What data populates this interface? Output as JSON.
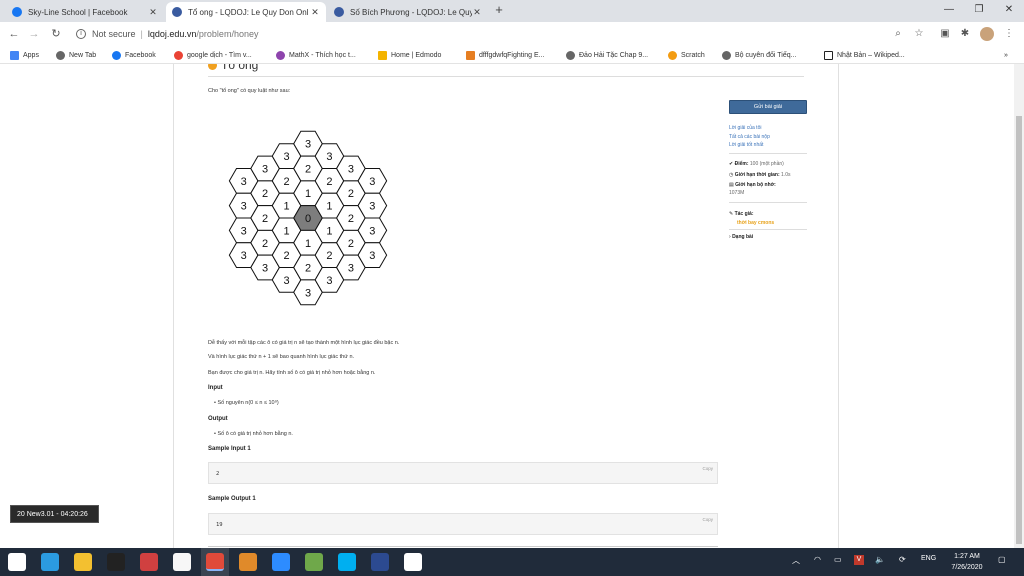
{
  "browser": {
    "tabs": [
      {
        "title": "Sky-Line School | Facebook",
        "favicon": "facebook-icon",
        "color": "#1877f2",
        "active": false
      },
      {
        "title": "Tổ ong - LQDOJ: Le Quy Don Onl",
        "favicon": "lqdoj-icon",
        "color": "#3a5ba0",
        "active": true
      },
      {
        "title": "Số Bích Phương - LQDOJ: Le Quy",
        "favicon": "lqdoj-icon",
        "color": "#3a5ba0",
        "active": false
      }
    ],
    "new_tab": "+",
    "window_controls": {
      "minimize": "—",
      "maximize": "❐",
      "close": "✕"
    }
  },
  "address_bar": {
    "security_text": "Not secure",
    "host": "lqdoj.edu.vn",
    "path": "/problem/honey"
  },
  "bookmarks": [
    {
      "label": "Apps",
      "icon": "apps-grid-icon",
      "color": "#4285f4"
    },
    {
      "label": "New Tab",
      "icon": "globe-icon",
      "color": "#666666"
    },
    {
      "label": "Facebook",
      "icon": "facebook-icon",
      "color": "#1877f2"
    },
    {
      "label": "google dịch - Tìm v...",
      "icon": "google-icon",
      "color": "#ea4335"
    },
    {
      "label": "MathX - Thích học t...",
      "icon": "mathx-icon",
      "color": "#8e44ad"
    },
    {
      "label": "Home | Edmodo",
      "icon": "edmodo-icon",
      "color": "#f4b400"
    },
    {
      "label": "dfffgdwfqFighting E...",
      "icon": "doc-icon",
      "color": "#e67e22"
    },
    {
      "label": "Đảo Hải Tặc Chap 9...",
      "icon": "globe-icon",
      "color": "#666666"
    },
    {
      "label": "Scratch",
      "icon": "scratch-icon",
      "color": "#f39c12"
    },
    {
      "label": "Bộ cuyên đổi Tiếq...",
      "icon": "globe-icon",
      "color": "#666666"
    },
    {
      "label": "Nhật Bản – Wikiped...",
      "icon": "wikipedia-icon",
      "color": "#222222"
    }
  ],
  "problem": {
    "title": "Tổ ong",
    "intro": "Cho \"tổ ong\" có quy luật như sau:",
    "honeycomb_cells": {
      "center": "0",
      "ring1": "1",
      "ring2": "2",
      "ring3": "3"
    },
    "desc1": "Dễ thấy với mỗi tập các ô có giá trị n sẽ tạo thành một hình lục giác đều bậc n.",
    "desc2": "Và hình lục giác thứ n + 1 sẽ bao quanh hình lục giác thứ n.",
    "desc3": "Bạn được cho giá trị n. Hãy tính số ô có giá trị nhỏ hơn hoặc bằng n.",
    "input_heading": "Input",
    "input_item": "Số nguyên n(0 ≤ n ≤ 10⁹)",
    "output_heading": "Output",
    "output_item": "Số ô có giá trị nhỏ hơn bằng n.",
    "sample_input_heading": "Sample Input 1",
    "sample_input_value": "2",
    "sample_output_heading": "Sample Output 1",
    "sample_output_value": "19",
    "copy_label": "Copy"
  },
  "sidebar": {
    "submit_label": "Gửi bài giải",
    "links": [
      "Lời giải của tôi",
      "Tất cả các bài nộp",
      "Lời giải tốt nhất"
    ],
    "points_label": "Điểm:",
    "points_value": "100 (một phần)",
    "time_label": "Giới hạn thời gian:",
    "time_value": "1.0s",
    "memory_label": "Giới hạn bộ nhớ:",
    "memory_value": "1073M",
    "author_label": "Tác giả:",
    "author_name": "thời bay cmons",
    "type_label": "Dạng bài"
  },
  "overlay": {
    "text": "20 New3.01 - 04:20:26"
  },
  "taskbar": {
    "apps": [
      {
        "name": "windows-start-icon",
        "color": "#ffffff"
      },
      {
        "name": "edge-icon",
        "color": "#2b9be0"
      },
      {
        "name": "file-explorer-icon",
        "color": "#f3c030"
      },
      {
        "name": "terminal-icon",
        "color": "#222222"
      },
      {
        "name": "paint-icon",
        "color": "#d04040"
      },
      {
        "name": "store-icon",
        "color": "#f7f7f7"
      },
      {
        "name": "chrome-icon",
        "color": "#e04a3a"
      },
      {
        "name": "game-icon",
        "color": "#e08a2a"
      },
      {
        "name": "zoom-icon",
        "color": "#2d8cff"
      },
      {
        "name": "minecraft-icon",
        "color": "#6fa84a"
      },
      {
        "name": "skype-icon",
        "color": "#00aff0"
      },
      {
        "name": "app-icon",
        "color": "#2c4a90"
      },
      {
        "name": "settings-icon",
        "color": "#ffffff"
      }
    ],
    "language": "ENG",
    "time": "1:27 AM",
    "date": "7/26/2020"
  }
}
